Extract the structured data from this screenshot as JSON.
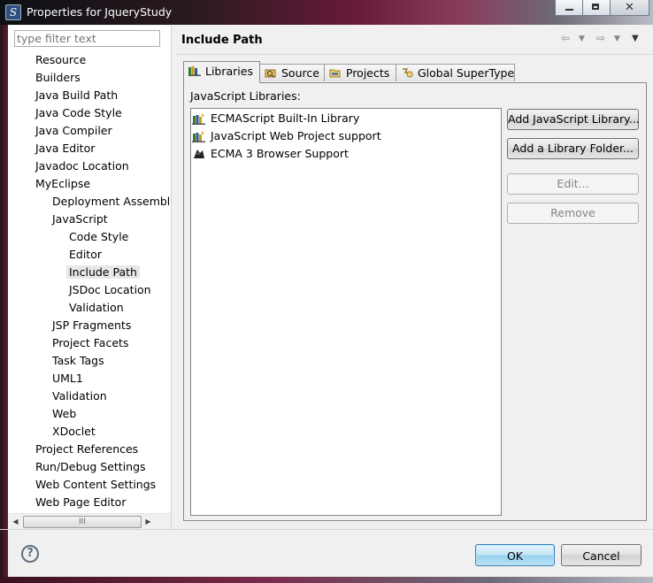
{
  "window": {
    "title": "Properties for JqueryStudy"
  },
  "filter": {
    "placeholder": "type filter text"
  },
  "tree": [
    {
      "label": "Resource",
      "level": 0
    },
    {
      "label": "Builders",
      "level": 0
    },
    {
      "label": "Java Build Path",
      "level": 0
    },
    {
      "label": "Java Code Style",
      "level": 0
    },
    {
      "label": "Java Compiler",
      "level": 0
    },
    {
      "label": "Java Editor",
      "level": 0
    },
    {
      "label": "Javadoc Location",
      "level": 0
    },
    {
      "label": "MyEclipse",
      "level": 0
    },
    {
      "label": "Deployment Assembl",
      "level": 1
    },
    {
      "label": "JavaScript",
      "level": 1
    },
    {
      "label": "Code Style",
      "level": 2
    },
    {
      "label": "Editor",
      "level": 2
    },
    {
      "label": "Include Path",
      "level": 2,
      "selected": true
    },
    {
      "label": "JSDoc Location",
      "level": 2
    },
    {
      "label": "Validation",
      "level": 2
    },
    {
      "label": "JSP Fragments",
      "level": 1
    },
    {
      "label": "Project Facets",
      "level": 1
    },
    {
      "label": "Task Tags",
      "level": 1
    },
    {
      "label": "UML1",
      "level": 1
    },
    {
      "label": "Validation",
      "level": 1
    },
    {
      "label": "Web",
      "level": 1
    },
    {
      "label": "XDoclet",
      "level": 1
    },
    {
      "label": "Project References",
      "level": 0
    },
    {
      "label": "Run/Debug Settings",
      "level": 0
    },
    {
      "label": "Web Content Settings",
      "level": 0
    },
    {
      "label": "Web Page Editor",
      "level": 0
    }
  ],
  "page": {
    "title": "Include Path"
  },
  "tabs": [
    {
      "label": "Libraries",
      "active": true,
      "icon": "libraries-icon"
    },
    {
      "label": "Source",
      "active": false,
      "icon": "source-icon"
    },
    {
      "label": "Projects",
      "active": false,
      "icon": "projects-icon"
    },
    {
      "label": "Global SuperType",
      "active": false,
      "icon": "global-supertype-icon"
    }
  ],
  "libraries": {
    "label": "JavaScript Libraries:",
    "items": [
      {
        "label": "ECMAScript Built-In Library",
        "icon": "library-icon"
      },
      {
        "label": "JavaScript Web Project support",
        "icon": "library-icon"
      },
      {
        "label": "ECMA 3 Browser Support",
        "icon": "browser-library-icon"
      }
    ]
  },
  "buttons": {
    "add_library": "Add JavaScript Library...",
    "add_folder": "Add a Library Folder...",
    "edit": "Edit...",
    "remove": "Remove"
  },
  "footer": {
    "ok": "OK",
    "cancel": "Cancel",
    "help": "?"
  },
  "scroll_glyph": "III"
}
